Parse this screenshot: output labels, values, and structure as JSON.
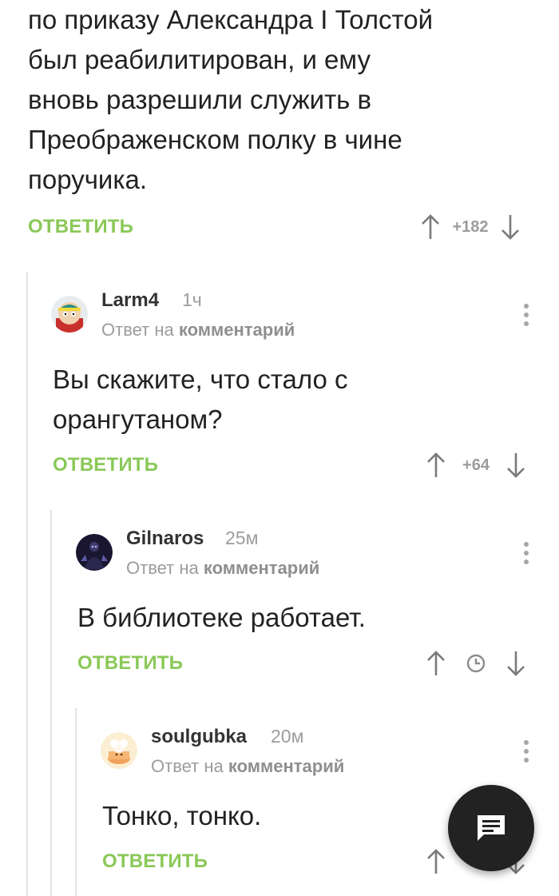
{
  "root_comment": {
    "text": "по приказу Александра I Толстой\nбыл реабилитирован, и ему\nвновь разрешили служить в\nПреображенском полку в чине\nпоручика.",
    "reply_label": "ОТВЕТИТЬ",
    "score": "+182"
  },
  "comments": [
    {
      "author": "Larm4",
      "time": "1ч",
      "reply_prefix": "Ответ на",
      "reply_target": "комментарий",
      "text": "Вы скажите, что стало с\nорангутаном?",
      "reply_label": "ОТВЕТИТЬ",
      "score": "+64",
      "avatar_icon": "cartman-avatar"
    },
    {
      "author": "Gilnaros",
      "time": "25м",
      "reply_prefix": "Ответ на",
      "reply_target": "комментарий",
      "text": "В библиотеке работает.",
      "reply_label": "ОТВЕТИТЬ",
      "score_icon": "clock-icon",
      "avatar_icon": "dark-figure-avatar"
    },
    {
      "author": "soulgubka",
      "time": "20м",
      "reply_prefix": "Ответ на",
      "reply_target": "комментарий",
      "text": "Тонко, тонко.",
      "reply_label": "ОТВЕТИТЬ",
      "avatar_icon": "chef-cake-avatar"
    }
  ],
  "fab": {
    "icon": "comment-icon"
  },
  "colors": {
    "accent_green": "#8ac858",
    "muted_gray": "#9c9c9c",
    "text": "#222222",
    "fab_bg": "#222222"
  }
}
